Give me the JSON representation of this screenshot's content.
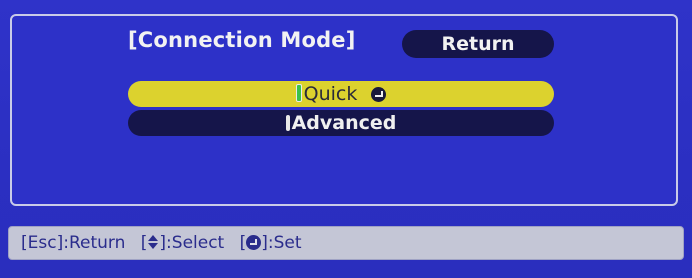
{
  "menu": {
    "title": "[Connection Mode]",
    "return_label": "Return",
    "options": [
      {
        "label": "Quick",
        "selected": true
      },
      {
        "label": "Advanced",
        "selected": false
      }
    ]
  },
  "footer": {
    "esc_key": "[Esc]",
    "esc_action": ":Return",
    "select_key_open": "[",
    "select_key_close": "]",
    "select_action": ":Select",
    "set_key_open": "[",
    "set_key_close": "]",
    "set_action": ":Set"
  },
  "icons": {
    "enter": "enter-icon",
    "updown": "up-down-arrow-icon",
    "set": "enter-icon"
  },
  "colors": {
    "background": "#2c30c4",
    "highlight": "#dcd22e",
    "option_dark": "#15154a",
    "footer_bg": "#c4c6d6",
    "footer_text": "#2a2c8c"
  }
}
